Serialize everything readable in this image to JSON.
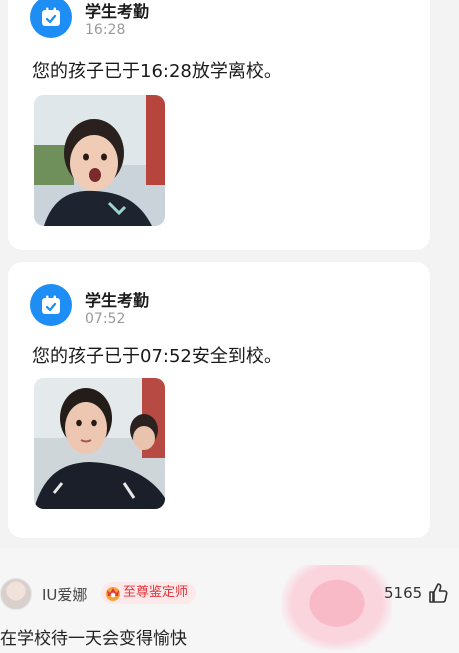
{
  "messages": [
    {
      "app_name": "学生考勤",
      "time": "16:28",
      "text": "您的孩子已于16:28放学离校。"
    },
    {
      "app_name": "学生考勤",
      "time": "07:52",
      "text": "您的孩子已于07:52安全到校。"
    }
  ],
  "comment": {
    "username": "IU爱娜",
    "badge": "至尊鉴定师",
    "likes": "5165",
    "text": "在学校待一天会变得愉快"
  },
  "icons": [
    "calendar-check-icon",
    "thumbs-up-icon",
    "crown-badge-icon"
  ],
  "colors": {
    "accent": "#1e8df4",
    "badge_red": "#e2353c"
  }
}
